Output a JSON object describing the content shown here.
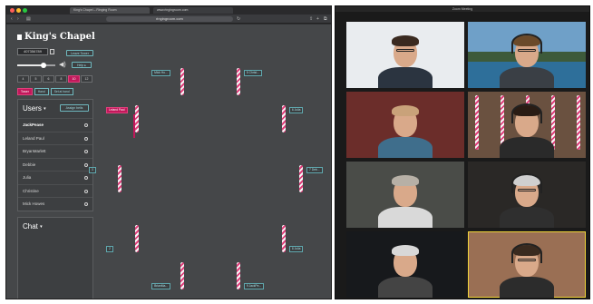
{
  "browser": {
    "tabs": [
      {
        "label": "King's Chapel – Ringing Room"
      },
      {
        "label": "www.ringingroom.com"
      }
    ],
    "url": "ringingroom.com",
    "nav": {
      "back": "‹",
      "forward": "›",
      "sidebar": "▤",
      "reload": "↻",
      "share": "⇪",
      "add": "+",
      "more": "⧉"
    }
  },
  "app": {
    "tower_name": "King's Chapel",
    "room_id": "407356789",
    "buttons": {
      "leave_tower": "Leave Tower",
      "help": "Help ▸"
    },
    "tower_sizes": [
      "4",
      "5",
      "6",
      "8",
      "10",
      "12"
    ],
    "selected_size": "10",
    "actions": [
      {
        "label": "Tower",
        "active": true
      },
      {
        "label": "Hand",
        "active": false
      },
      {
        "label": "Set at hand",
        "active": false
      }
    ],
    "volume_level": 0.7,
    "users_panel": {
      "title": "Users",
      "assign_button": "Assign bells",
      "users": [
        {
          "name": "JackPease",
          "bold": true
        },
        {
          "name": "Leland Paul",
          "bold": false
        },
        {
          "name": "BryanMarlett",
          "bold": false
        },
        {
          "name": "Debbie",
          "bold": false
        },
        {
          "name": "Julia",
          "bold": false
        },
        {
          "name": "Christine",
          "bold": false
        },
        {
          "name": "Mick Howes",
          "bold": false
        }
      ]
    },
    "chat_panel": {
      "title": "Chat"
    },
    "bells": [
      {
        "label": "Mick Ho...",
        "assigned": false
      },
      {
        "label": "5 Christ...",
        "assigned": false
      },
      {
        "label": "Leland Paul",
        "assigned": true
      },
      {
        "label": "6 Julia",
        "assigned": false
      },
      {
        "label": "3",
        "assigned": false
      },
      {
        "label": "7 Deb...",
        "assigned": false
      },
      {
        "label": "2",
        "assigned": false
      },
      {
        "label": "8 Julia",
        "assigned": false
      },
      {
        "label": "BrianMa...",
        "assigned": false
      },
      {
        "label": "9 JackPe...",
        "assigned": false
      }
    ]
  },
  "zoom": {
    "title": "Zoom Meeting",
    "participants": [
      {
        "name": "",
        "bg": "#e9ecef"
      },
      {
        "name": "",
        "bg": "#5b8fb5"
      },
      {
        "name": "",
        "bg": "#6b2d2a"
      },
      {
        "name": "",
        "bg": "#6a5140"
      },
      {
        "name": "",
        "bg": "#4a4c48"
      },
      {
        "name": "",
        "bg": "#2a2826"
      },
      {
        "name": "",
        "bg": "#17191c"
      },
      {
        "name": "",
        "bg": "#9a6f54"
      }
    ]
  },
  "colors": {
    "accent": "#c2185b",
    "teal": "#6fb8be",
    "app_bg": "#454749",
    "speaker_highlight": "#f2d53a"
  }
}
